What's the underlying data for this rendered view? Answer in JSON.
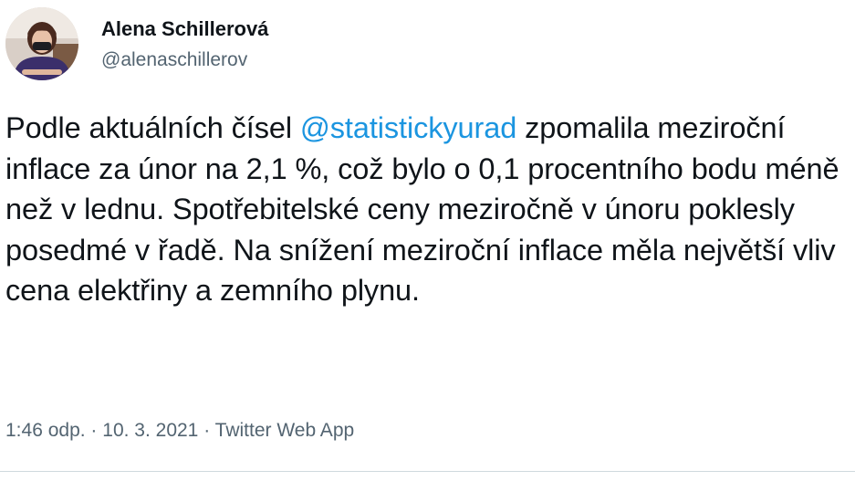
{
  "author": {
    "display_name": "Alena Schillerová",
    "handle": "@alenaschillerov"
  },
  "tweet": {
    "text_before_mention": "Podle aktuálních čísel ",
    "mention": "@statistickyurad",
    "text_after_mention": " zpomalila meziroční inflace za únor na 2,1 %, což bylo o 0,1 procentního bodu méně než v lednu. Spotřebitelské ceny meziročně v únoru poklesly posedmé v řadě. Na snížení meziroční inflace měla největší vliv cena elektřiny a zemního plynu."
  },
  "meta": {
    "time": "1:46 odp.",
    "separator": " · ",
    "date": "10. 3. 2021",
    "source": "Twitter Web App"
  },
  "colors": {
    "text": "#0f1419",
    "secondary": "#536471",
    "link": "#1b95e0",
    "divider": "#cfd9de"
  }
}
